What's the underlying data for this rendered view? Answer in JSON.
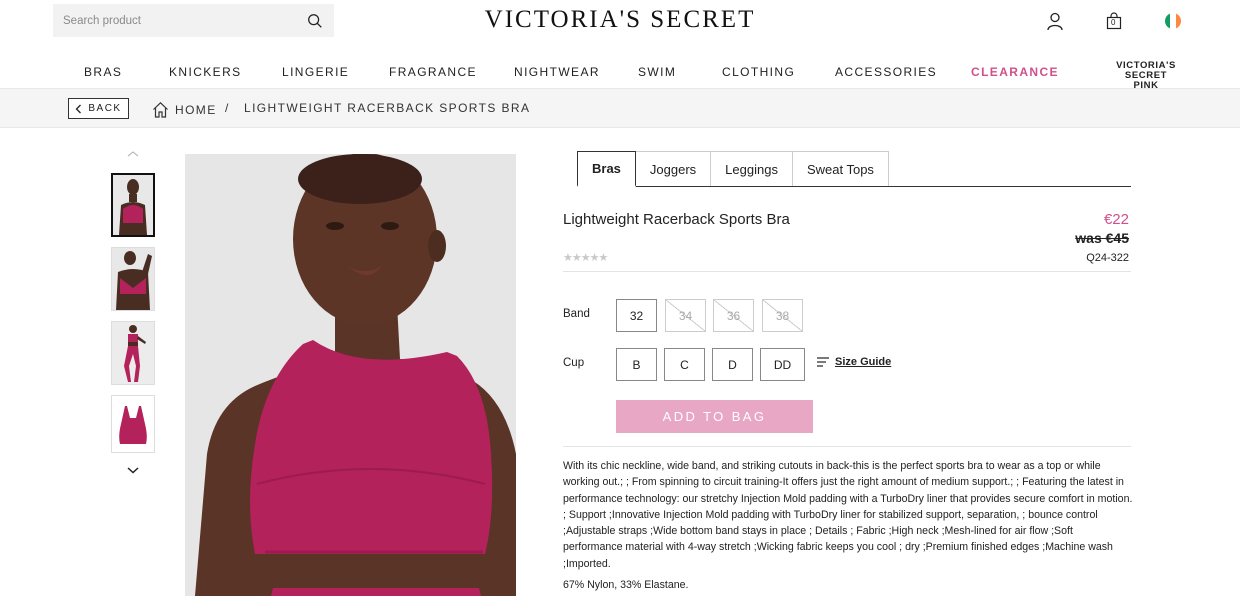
{
  "header": {
    "search_placeholder": "Search product",
    "logo": "VICTORIA'S SECRET",
    "icons": [
      "search-icon",
      "user-icon",
      "bag-icon",
      "ireland-flag-icon"
    ],
    "bag_count": "0"
  },
  "nav": {
    "items": [
      "BRAS",
      "KNICKERS",
      "LINGERIE",
      "FRAGRANCE",
      "NIGHTWEAR",
      "SWIM",
      "CLOTHING",
      "ACCESSORIES",
      "CLEARANCE"
    ],
    "pink_brand_line1": "VICTORIA'S SECRET",
    "pink_brand_line2": "PINK",
    "clearance_color": "#d0508c"
  },
  "breadcrumb": {
    "back": "BACK",
    "home": "HOME",
    "separator": "/",
    "current": "LIGHTWEIGHT RACERBACK SPORTS BRA"
  },
  "gallery": {
    "thumb_count": 4,
    "active_thumb": 0,
    "product_color": "#b3225a"
  },
  "product": {
    "tabs": [
      "Bras",
      "Joggers",
      "Leggings",
      "Sweat Tops"
    ],
    "active_tab": "Bras",
    "title": "Lightweight Racerback Sports Bra",
    "price": "€22",
    "was_price": "was €45",
    "sku": "Q24-322",
    "rating_stars": "★★★★★",
    "band_label": "Band",
    "band_sizes": [
      {
        "label": "32",
        "available": true
      },
      {
        "label": "34",
        "available": false
      },
      {
        "label": "36",
        "available": false
      },
      {
        "label": "38",
        "available": false
      }
    ],
    "cup_label": "Cup",
    "cup_sizes": [
      "B",
      "C",
      "D",
      "DD"
    ],
    "size_guide": "Size Guide",
    "add_to_bag": "ADD TO BAG",
    "description": "With its chic neckline, wide band, and striking cutouts in back-this is the perfect sports bra to wear as a top or while working out.; ; From spinning to circuit training-It offers just the right amount of medium support.; ; Featuring the latest in performance technology: our stretchy Injection Mold padding with a TurboDry liner that provides secure comfort in motion. ; Support ;Innovative Injection Mold padding with TurboDry liner for stabilized support, separation, ; bounce control ;Adjustable straps ;Wide bottom band stays in place ; Details ; Fabric ;High neck ;Mesh-lined for air flow ;Soft performance material with 4-way stretch ;Wicking fabric keeps you cool ; dry ;Premium finished edges ;Machine wash ;Imported.",
    "composition": "67% Nylon, 33% Elastane."
  }
}
